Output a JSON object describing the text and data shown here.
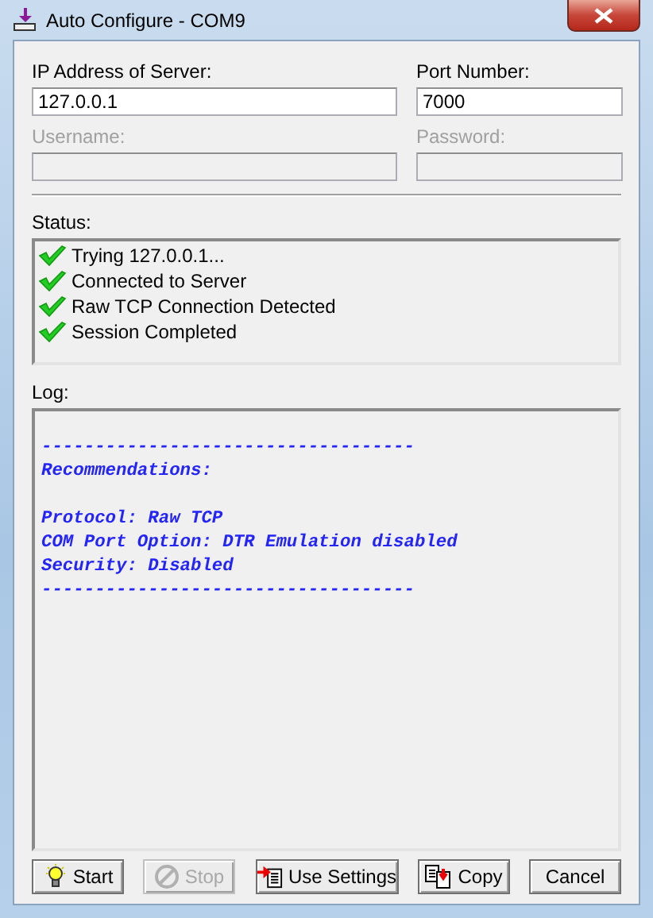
{
  "window": {
    "title": "Auto Configure - COM9"
  },
  "fields": [
    {
      "label": "IP Address of Server:",
      "value": "127.0.0.1",
      "disabled": false
    },
    {
      "label": "Port Number:",
      "value": "7000",
      "disabled": false
    },
    {
      "label": "Username:",
      "disabled": true
    },
    {
      "label": "Password:",
      "disabled": true
    }
  ],
  "status": {
    "label": "Status:",
    "items": [
      {
        "text": "Trying 127.0.0.1..."
      },
      {
        "text": "Connected to Server"
      },
      {
        "text": "Raw TCP Connection Detected"
      },
      {
        "text": "Session Completed"
      }
    ]
  },
  "log": {
    "label": "Log:",
    "lines": [
      {
        "kind": "gap"
      },
      {
        "kind": "text",
        "text": "-----------------------------------"
      },
      {
        "kind": "heading",
        "text": "Recommendations:"
      },
      {
        "kind": "gap"
      },
      {
        "kind": "text",
        "text": "Protocol: Raw TCP"
      },
      {
        "kind": "text",
        "text": "COM Port Option: DTR Emulation disabled"
      },
      {
        "kind": "text",
        "text": "Security: Disabled"
      },
      {
        "kind": "text",
        "text": "-----------------------------------"
      }
    ]
  },
  "buttons": [
    {
      "label": "Start",
      "disabled": false
    },
    {
      "label": "Stop",
      "disabled": true
    },
    {
      "label": "Use Settings",
      "disabled": false
    },
    {
      "label": "Copy",
      "disabled": false
    },
    {
      "label": "Cancel",
      "disabled": false
    }
  ]
}
